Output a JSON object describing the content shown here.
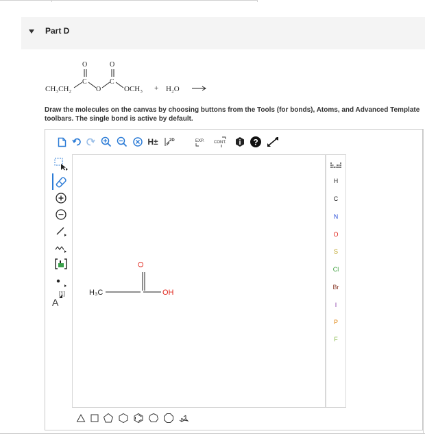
{
  "part": {
    "title": "Part D"
  },
  "reaction": {
    "left_group": "CH₃CH₂",
    "carbonyl_o1": "O",
    "carbonyl_o2": "O",
    "c1": "C",
    "c2": "C",
    "bridge_o": "O",
    "right_group": "OCH₃",
    "plus": "+",
    "water": "H₂O"
  },
  "instructions": "Draw the molecules on the canvas by choosing buttons from the Tools (for bonds), Atoms, and Advanced Template toolbars. The single bond is active by default.",
  "toolbar": {
    "h_label": "H±",
    "two_d": "2D",
    "exp": "EXP.",
    "cont": "CONT."
  },
  "left_tools": {
    "charge_label": "[1]",
    "atom_label": "A"
  },
  "canvas_molecule": {
    "left": "H₃C",
    "right": "OH",
    "top": "O"
  },
  "atoms": [
    "H",
    "C",
    "N",
    "O",
    "S",
    "Cl",
    "Br",
    "I",
    "P",
    "F"
  ],
  "colors": {
    "accent_blue": "#2b7bd6",
    "oxygen_red": "#e0251b",
    "nitrogen_blue": "#2a4fd8",
    "sulfur_olive": "#b79b12",
    "chlorine_green": "#3a9e3a",
    "bromine_brown": "#8b3a2a",
    "iodine_purple": "#8a3fa8",
    "phosphorus_orange": "#e08a18",
    "fluorine_green": "#86b84a"
  }
}
